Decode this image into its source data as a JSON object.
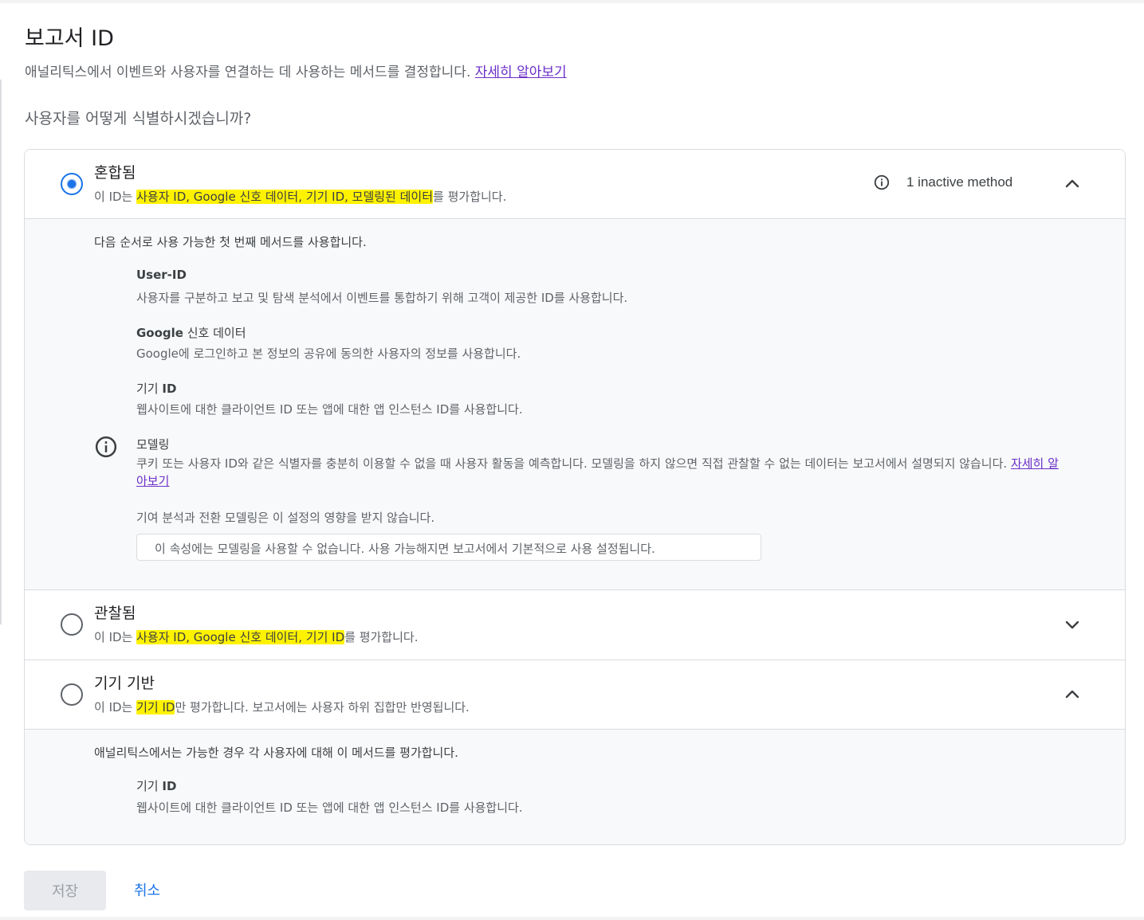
{
  "page": {
    "title": "보고서 ID",
    "description": "애널리틱스에서 이벤트와 사용자를 연결하는 데 사용하는 메서드를 결정합니다.",
    "learn_more": "자세히 알아보기",
    "question": "사용자를 어떻게 식별하시겠습니까?"
  },
  "options": [
    {
      "title": "혼합됨",
      "sub_prefix": "이 ID는 ",
      "sub_highlight": "사용자 ID, Google 신호 데이터, 기기 ID, 모델링된 데이터",
      "sub_suffix": "를 평가합니다.",
      "selected": true,
      "expanded": true,
      "inactive_label": "1 inactive method",
      "inactive_icon": "info-icon",
      "details": {
        "intro": "다음 순서로 사용 가능한 첫 번째 메서드를 사용합니다.",
        "methods": [
          {
            "title_bold": "User-ID",
            "title_regular": "",
            "desc": "사용자를 구분하고 보고 및 탐색 분석에서 이벤트를 통합하기 위해 고객이 제공한 ID를 사용합니다."
          },
          {
            "title_bold": "Google",
            "title_regular": " 신호 데이터",
            "desc": "Google에 로그인하고 본 정보의 공유에 동의한 사용자의 정보를 사용합니다."
          },
          {
            "title_regular": "기기 ",
            "title_bold": "ID",
            "desc": "웹사이트에 대한 클라이언트 ID 또는 앱에 대한 앱 인스턴스 ID를 사용합니다."
          }
        ],
        "modeling": {
          "title": "모델링",
          "desc": "쿠키 또는 사용자 ID와 같은 식별자를 충분히 이용할 수 없을 때 사용자 활동을 예측합니다. 모델링을 하지 않으면 직접 관찰할 수 없는 데이터는 보고서에서 설명되지 않습니다.",
          "learn_more": "자세히 알아보기",
          "note": "기여 분석과 전환 모델링은 이 설정의 영향을 받지 않습니다.",
          "notice": "이 속성에는 모델링을 사용할 수 없습니다. 사용 가능해지면 보고서에서 기본적으로 사용 설정됩니다."
        }
      }
    },
    {
      "title": "관찰됨",
      "sub_prefix": "이 ID는 ",
      "sub_highlight": "사용자 ID, Google 신호 데이터, 기기 ID",
      "sub_suffix": "를 평가합니다.",
      "selected": false,
      "expanded": false
    },
    {
      "title": "기기 기반",
      "sub_prefix": "이 ID는 ",
      "sub_highlight": "기기 ID",
      "sub_suffix": "만 평가합니다. 보고서에는 사용자 하위 집합만 반영됩니다.",
      "selected": false,
      "expanded": true,
      "details": {
        "intro": "애널리틱스에서는 가능한 경우 각 사용자에 대해 이 메서드를 평가합니다.",
        "methods": [
          {
            "title_regular": "기기 ",
            "title_bold": "ID",
            "desc": "웹사이트에 대한 클라이언트 ID 또는 앱에 대한 앱 인스턴스 ID를 사용합니다."
          }
        ]
      }
    }
  ],
  "actions": {
    "save": "저장",
    "cancel": "취소"
  },
  "colors": {
    "accent": "#1a73e8",
    "highlight": "#fff200",
    "link": "#6b2fc9"
  }
}
